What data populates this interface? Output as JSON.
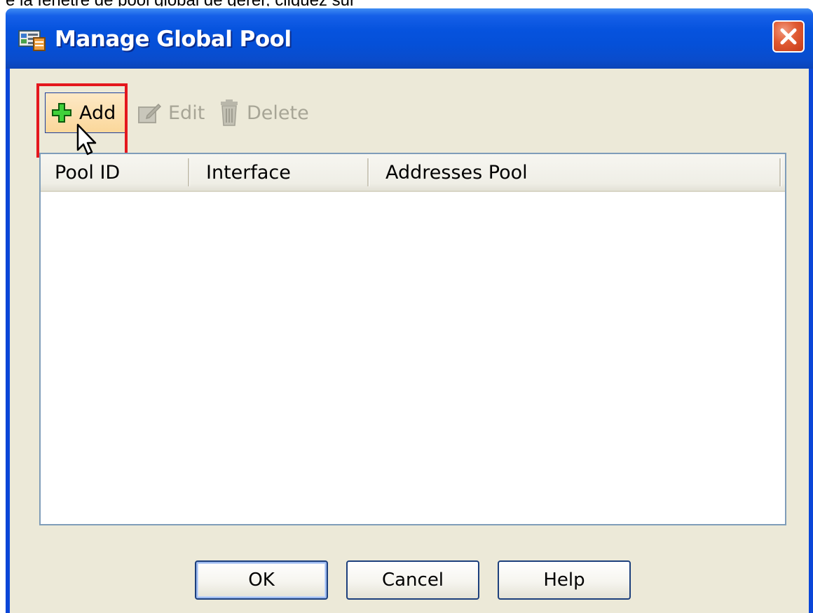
{
  "caption": {
    "text": "e la fenêtre de pool global de gérer, cliquez sur"
  },
  "window": {
    "title": "Manage Global Pool",
    "icons": {
      "title": "pool-app-icon",
      "close": "close-icon"
    }
  },
  "toolbar": {
    "add_label": "Add",
    "edit_label": "Edit",
    "delete_label": "Delete",
    "icons": {
      "add": "plus-icon",
      "edit": "edit-icon",
      "delete": "trash-icon"
    }
  },
  "table": {
    "columns": [
      "Pool ID",
      "Interface",
      "Addresses Pool"
    ],
    "rows": []
  },
  "buttons": {
    "ok_label": "OK",
    "cancel_label": "Cancel",
    "help_label": "Help"
  },
  "colors": {
    "titlebar": "#0554de",
    "client_bg": "#ece9d8",
    "highlight": "#e4171d",
    "disabled_text": "#a7a596"
  }
}
